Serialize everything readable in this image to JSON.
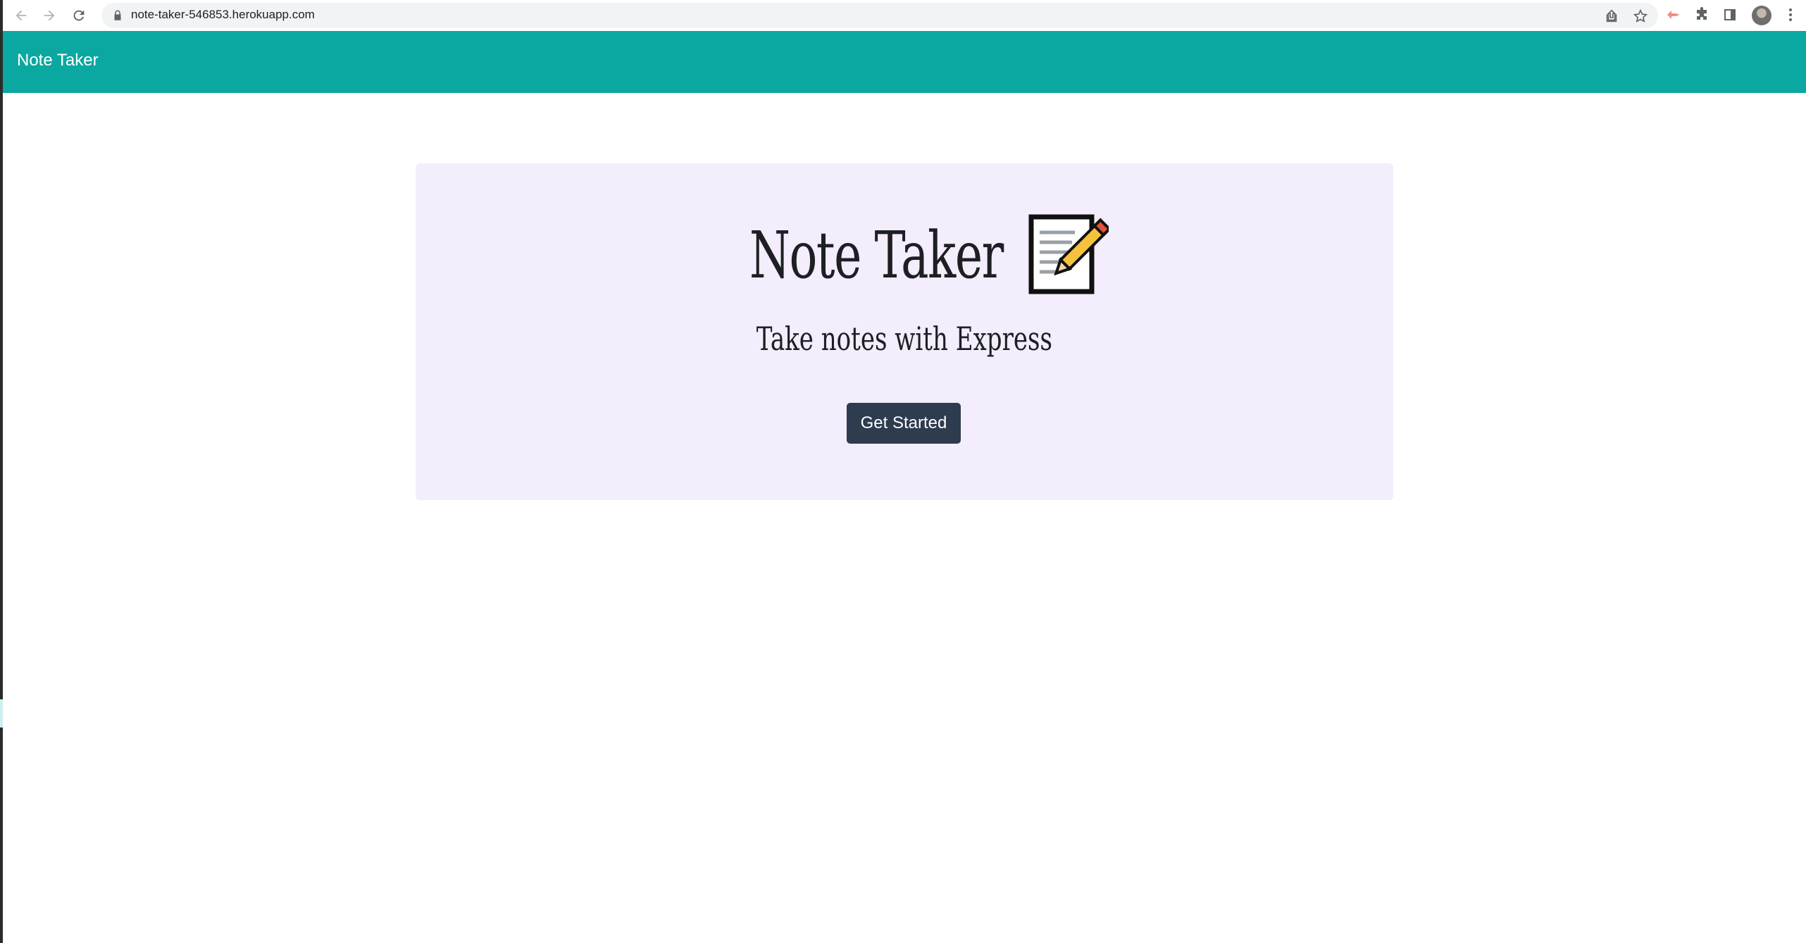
{
  "browser": {
    "url": "note-taker-546853.herokuapp.com"
  },
  "navbar": {
    "brand": "Note Taker"
  },
  "hero": {
    "title": "Note Taker",
    "title_icon": "memo-icon",
    "subtitle": "Take notes with Express",
    "cta_label": "Get Started"
  },
  "colors": {
    "navbar_bg": "#0aa8a1",
    "hero_bg": "#f3edfc",
    "button_bg": "#2d3c4e"
  }
}
